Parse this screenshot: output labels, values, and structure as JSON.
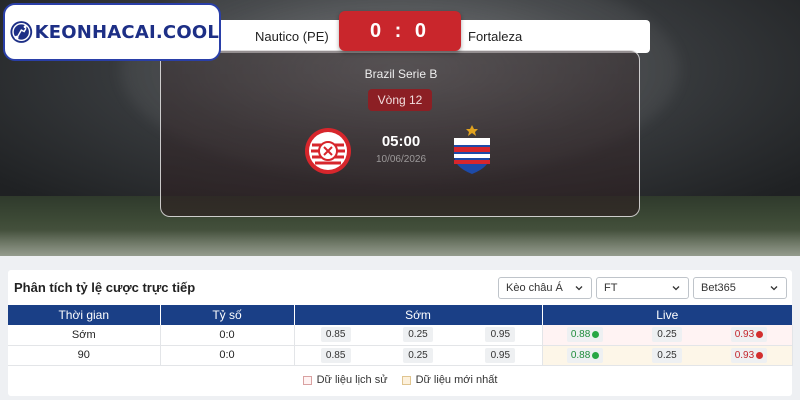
{
  "logo": {
    "text": "KEONHACAI.COOL"
  },
  "match": {
    "home": "Nautico (PE)",
    "away": "Fortaleza",
    "score": "0 : 0",
    "league": "Brazil Serie B",
    "round": "Vòng 12",
    "time": "05:00",
    "date": "10/06/2026"
  },
  "odds_panel": {
    "title": "Phân tích tỷ lệ cược trực tiếp",
    "selects": {
      "market": "Kèo châu Á",
      "period": "FT",
      "bookmaker": "Bet365"
    },
    "headers": {
      "time": "Thời gian",
      "score": "Tỷ số",
      "early": "Sớm",
      "live": "Live"
    },
    "rows": [
      {
        "time": "Sớm",
        "score": "0:0",
        "early": [
          "0.85",
          "0.25",
          "0.95"
        ],
        "live": [
          "0.88",
          "0.25",
          "0.93"
        ]
      },
      {
        "time": "90",
        "score": "0:0",
        "early": [
          "0.85",
          "0.25",
          "0.95"
        ],
        "live": [
          "0.88",
          "0.25",
          "0.93"
        ]
      }
    ],
    "legend": {
      "history": "Dữ liệu lịch sử",
      "latest": "Dữ liệu mới nhất"
    }
  },
  "colors": {
    "accent_red": "#c9262c",
    "header_blue": "#1a3f86",
    "odds_up": "#1f8c3b",
    "odds_down": "#c4262c"
  }
}
